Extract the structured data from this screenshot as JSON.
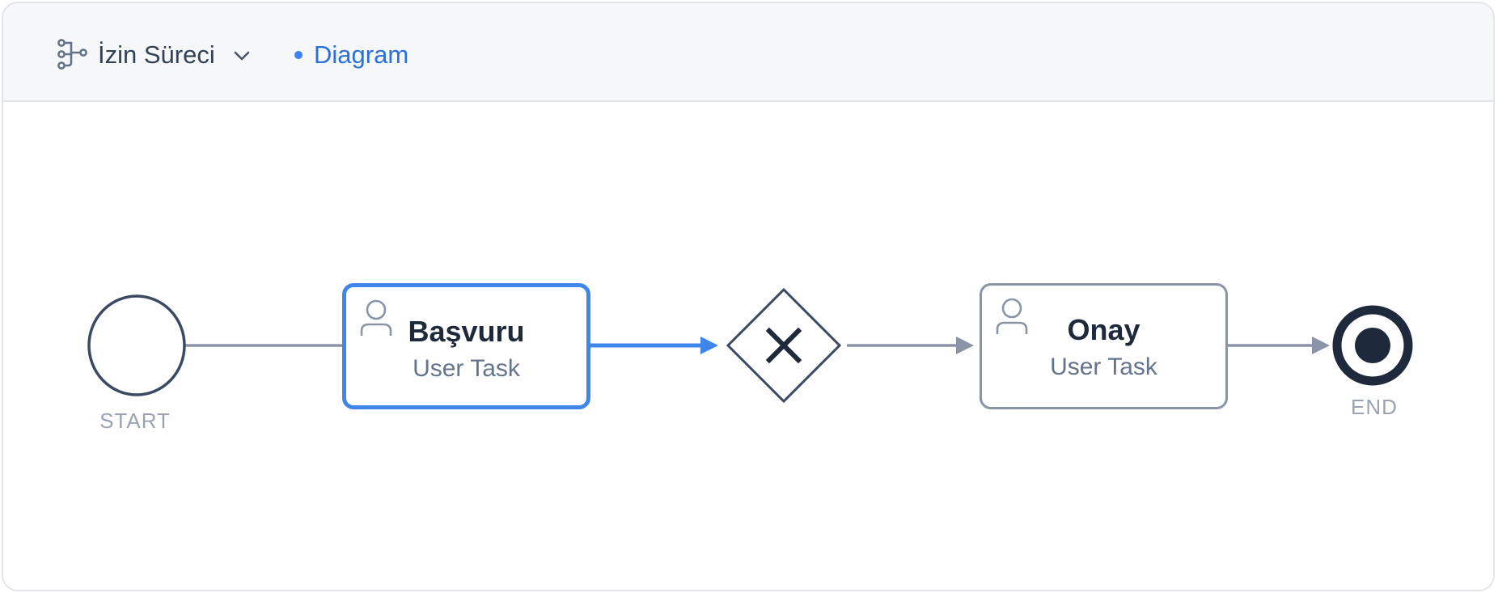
{
  "header": {
    "process_name": "İzin Süreci",
    "tab_label": "Diagram",
    "process_icon": "process-tree-icon",
    "dropdown_icon": "chevron-down-icon"
  },
  "diagram": {
    "start_label": "START",
    "end_label": "END",
    "tasks": [
      {
        "title": "Başvuru",
        "subtitle": "User Task",
        "icon": "user-icon",
        "selected": true
      },
      {
        "title": "Onay",
        "subtitle": "User Task",
        "icon": "user-icon",
        "selected": false
      }
    ],
    "gateway": {
      "type": "exclusive",
      "icon": "x-icon"
    }
  },
  "colors": {
    "accent": "#3f86ea",
    "node_stroke": "#3b4a63",
    "flow": "#8a94a6",
    "text_dark": "#1e293b",
    "text_muted": "#9aa3af"
  }
}
